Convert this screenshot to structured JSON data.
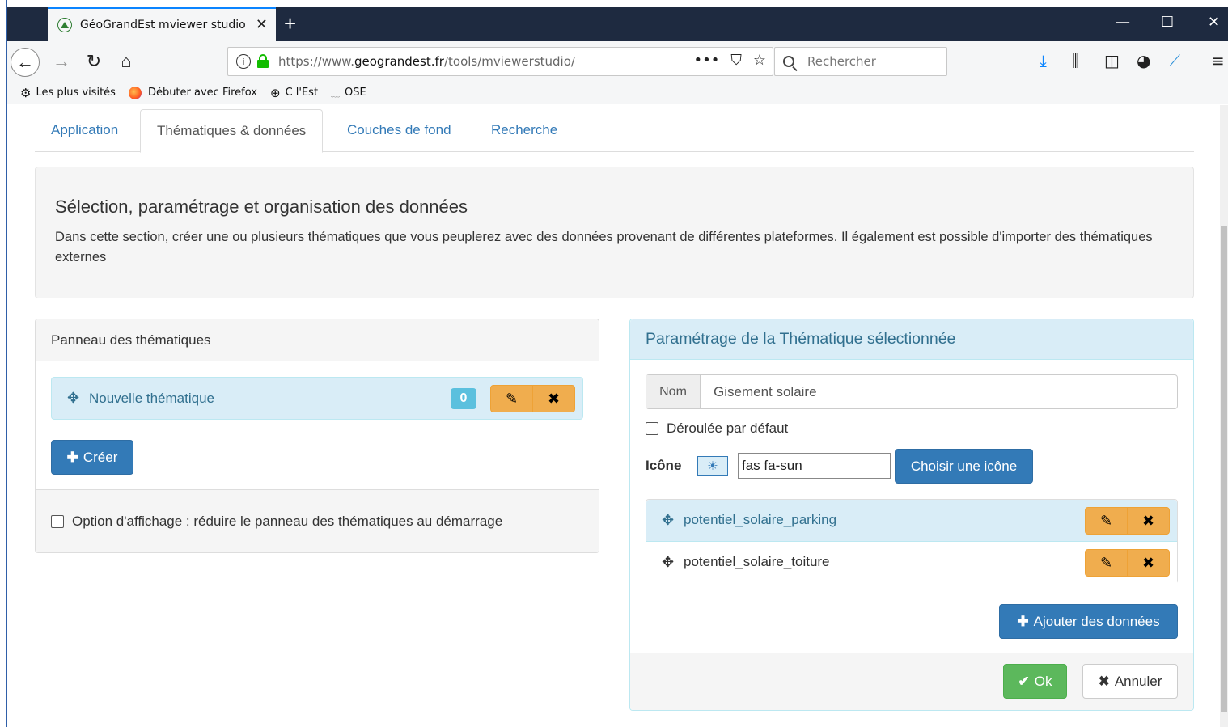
{
  "browser": {
    "tab_title": "GéoGrandEst mviewer studio",
    "tab_close": "✕",
    "new_tab": "+",
    "window_controls": {
      "minimize": "—",
      "maximize": "☐",
      "close": "✕"
    },
    "url_prefix": "https://www.",
    "url_domain": "geograndest.fr",
    "url_path": "/tools/mviewerstudio/",
    "search_placeholder": "Rechercher",
    "page_actions": [
      "•••",
      "⛉",
      "☆"
    ],
    "bookmarks": [
      {
        "icon": "gear-icon",
        "label": "Les plus visités"
      },
      {
        "icon": "firefox-icon",
        "label": "Débuter avec Firefox"
      },
      {
        "icon": "globe-icon",
        "label": "C l'Est"
      },
      {
        "icon": "ose-icon",
        "label": "OSE"
      }
    ]
  },
  "tabs": [
    {
      "label": "Application",
      "active": false
    },
    {
      "label": "Thématiques & données",
      "active": true
    },
    {
      "label": "Couches de fond",
      "active": false
    },
    {
      "label": "Recherche",
      "active": false
    }
  ],
  "intro": {
    "title": "Sélection, paramétrage et organisation des données",
    "text": "Dans cette section, créer une ou plusieurs thématiques que vous peuplerez avec des données provenant de différentes plateformes. Il également est possible d'importer des thématiques externes"
  },
  "themes_panel": {
    "title": "Panneau des thématiques",
    "items": [
      {
        "name": "Nouvelle thématique",
        "count": "0"
      }
    ],
    "create_label": "Créer",
    "option_label": "Option d'affichage : réduire le panneau des thématiques au démarrage",
    "option_checked": false
  },
  "theme_settings": {
    "title": "Paramétrage de la Thématique sélectionnée",
    "name_label": "Nom",
    "name_value": "Gisement solaire",
    "expanded_label": "Déroulée par défaut",
    "expanded_checked": false,
    "icon_label": "Icône",
    "icon_value": "fas fa-sun",
    "choose_icon_label": "Choisir une icône",
    "layers": [
      {
        "name": "potentiel_solaire_parking",
        "selected": true
      },
      {
        "name": "potentiel_solaire_toiture",
        "selected": false
      }
    ],
    "add_data_label": "Ajouter des données",
    "ok_label": "Ok",
    "cancel_label": "Annuler"
  },
  "colors": {
    "primary": "#337ab7",
    "info_bg": "#d9edf7",
    "info_text": "#31708f",
    "warning": "#f0ad4e",
    "success": "#5cb85c",
    "badge": "#5bc0de"
  }
}
